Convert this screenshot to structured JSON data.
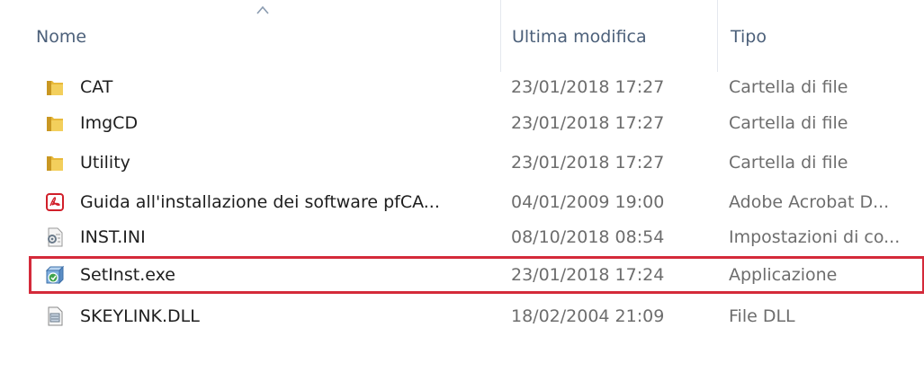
{
  "columns": {
    "name": "Nome",
    "date": "Ultima modifica",
    "type": "Tipo"
  },
  "colors": {
    "folder": "#e8b93a",
    "highlight_border": "#d42a3a",
    "header_text": "#4c607a"
  },
  "files": [
    {
      "name": "CAT",
      "date": "23/01/2018 17:27",
      "type": "Cartella di file",
      "icon": "folder-icon"
    },
    {
      "name": "ImgCD",
      "date": "23/01/2018 17:27",
      "type": "Cartella di file",
      "icon": "folder-icon"
    },
    {
      "name": "Utility",
      "date": "23/01/2018 17:27",
      "type": "Cartella di file",
      "icon": "folder-icon"
    },
    {
      "name": "Guida all'installazione dei software pfCA...",
      "date": "04/01/2009 19:00",
      "type": "Adobe Acrobat D...",
      "icon": "pdf-icon"
    },
    {
      "name": "INST.INI",
      "date": "08/10/2018 08:54",
      "type": "Impostazioni di co...",
      "icon": "ini-settings-icon"
    },
    {
      "name": "SetInst.exe",
      "date": "23/01/2018 17:24",
      "type": "Applicazione",
      "icon": "setup-exe-icon",
      "highlighted": true
    },
    {
      "name": "SKEYLINK.DLL",
      "date": "18/02/2004 21:09",
      "type": "File DLL",
      "icon": "dll-file-icon"
    }
  ]
}
